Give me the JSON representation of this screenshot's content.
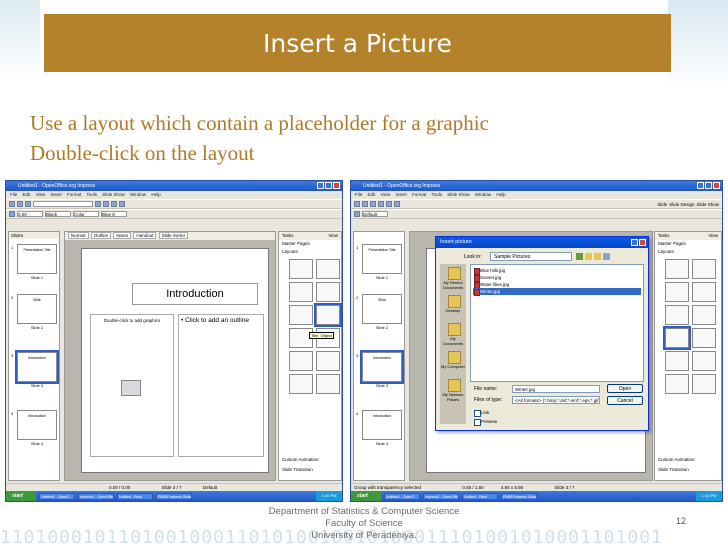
{
  "slide": {
    "title": "Insert a Picture",
    "bullets": [
      "Use  a layout which contain a placeholder for a graphic",
      "Double-click on the layout"
    ],
    "footer_lines": [
      "Department of Statistics & Computer Science",
      "Faculty of Science",
      "University of Peradeniya."
    ],
    "page_number": "12",
    "binary_deco": "11010001011010010001101010010010100011101001010001101001"
  },
  "left_window": {
    "title": "Untitled1 - OpenOffice.org Impress",
    "menu": [
      "File",
      "Edit",
      "View",
      "Insert",
      "Format",
      "Tools",
      "Slide Show",
      "Window",
      "Help"
    ],
    "toolbar_fields": [
      "0.00",
      "Black",
      "Color",
      "Blue 8"
    ],
    "slides_label": "Slides",
    "tabs": [
      "Normal",
      "Outline",
      "Notes",
      "Handout",
      "Slide Sorter"
    ],
    "slide_title": "Introduction",
    "left_placeholder": "Double-click to add graphics",
    "right_placeholder": "• Click to add an outline",
    "tasks_label": "Tasks",
    "view_label": "View",
    "master_pages": "Master Pages",
    "layouts": "Layouts",
    "tooltip": "Title, Object",
    "custom_animation": "Custom Animation",
    "slide_transition": "Slide Transition",
    "thumbs": [
      {
        "num": "1",
        "text": "Presentation Title",
        "cap": "Slide 1"
      },
      {
        "num": "2",
        "text": "Slide",
        "cap": "Slide 2"
      },
      {
        "num": "3",
        "text": "Introduction",
        "cap": "Slide 3"
      },
      {
        "num": "4",
        "text": "Introduction",
        "cap": "Slide 4"
      }
    ],
    "status": "Default",
    "status_pos": "0.00 / 0.00",
    "status_slide": "Slide 3 / 7",
    "taskbar": {
      "start": "start",
      "items": [
        "Untitled1 - OpenO...",
        "Impress2 - OpenOffic...",
        "Untitled - Paint",
        "PBBSI Impress Guide..."
      ],
      "clock": "1:10 PM"
    }
  },
  "right_window": {
    "title": "Untitled1 - OpenOffice.org Impress",
    "menu": [
      "File",
      "Edit",
      "View",
      "Insert",
      "Format",
      "Tools",
      "Slide Show",
      "Window",
      "Help"
    ],
    "toolbar_fields": [
      "Default"
    ],
    "toolbar_buttons": [
      "Slide",
      "Slide Design",
      "Slide Show"
    ],
    "tasks_label": "Tasks",
    "view_label": "View",
    "master_pages": "Master Pages",
    "layouts": "Layouts",
    "custom_animation": "Custom Animation",
    "slide_transition": "Slide Transition",
    "thumbs": [
      {
        "num": "1",
        "text": "Presentation Title",
        "cap": "Slide 1"
      },
      {
        "num": "2",
        "text": "Slide",
        "cap": "Slide 2"
      },
      {
        "num": "3",
        "text": "Introduction",
        "cap": "Slide 3"
      },
      {
        "num": "4",
        "text": "Introduction",
        "cap": "Slide 4"
      }
    ],
    "dialog": {
      "title": "Insert picture",
      "look_in_label": "Look in:",
      "look_in_value": "Sample Pictures",
      "places": [
        "My Recent Documents",
        "Desktop",
        "My Documents",
        "My Computer",
        "My Network Places"
      ],
      "files": [
        "Blue hills.jpg",
        "Sunset.jpg",
        "Water lilies.jpg",
        "Winter.jpg"
      ],
      "file_name_label": "File name:",
      "file_name_value": "Winter.jpg",
      "file_type_label": "Files of type:",
      "file_type_value": "<All formats> (*.bmp;*.dxf;*.emf;*.eps;*.gif;*.jpg)",
      "open_button": "Open",
      "cancel_button": "Cancel",
      "link_label": "Link",
      "preview_label": "Preview"
    },
    "status": "Group with transparency selected",
    "status_pos": "0.55 / 1.60",
    "status_size": "4.84 x 5.86",
    "status_slide": "Slide 3 / 7",
    "taskbar": {
      "start": "start",
      "items": [
        "Untitled1 - OpenO...",
        "Impress2 - OpenOffic...",
        "Untitled - Paint",
        "PBBSI Impress Guide..."
      ],
      "clock": "1:12 PM"
    }
  }
}
